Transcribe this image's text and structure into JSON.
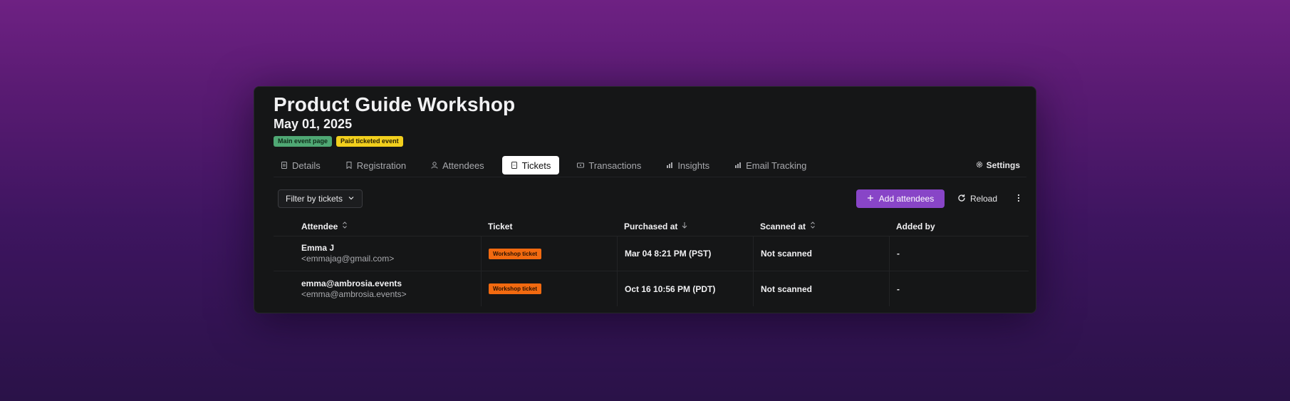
{
  "event": {
    "title": "Product Guide Workshop",
    "date": "May 01, 2025",
    "badges": [
      {
        "label": "Main event page",
        "color": "#4fa874"
      },
      {
        "label": "Paid ticketed event",
        "color": "#f2cf1d"
      }
    ]
  },
  "tabs": [
    {
      "label": "Details",
      "icon": "document-icon",
      "active": false
    },
    {
      "label": "Registration",
      "icon": "bookmark-icon",
      "active": false
    },
    {
      "label": "Attendees",
      "icon": "user-icon",
      "active": false
    },
    {
      "label": "Tickets",
      "icon": "ticket-icon",
      "active": true
    },
    {
      "label": "Transactions",
      "icon": "card-icon",
      "active": false
    },
    {
      "label": "Insights",
      "icon": "bar-chart-icon",
      "active": false
    },
    {
      "label": "Email Tracking",
      "icon": "bar-chart-icon",
      "active": false
    }
  ],
  "settings_label": "Settings",
  "toolbar": {
    "filter_label": "Filter by tickets",
    "add_label": "Add attendees",
    "reload_label": "Reload",
    "accent": "#8845c7"
  },
  "table": {
    "columns": [
      {
        "label": "Attendee",
        "sort": "unsorted"
      },
      {
        "label": "Ticket",
        "sort": "none"
      },
      {
        "label": "Purchased at",
        "sort": "descending"
      },
      {
        "label": "Scanned at",
        "sort": "unsorted"
      },
      {
        "label": "Added by",
        "sort": "none"
      }
    ],
    "rows": [
      {
        "name": "Emma J",
        "email": "<emmajag@gmail.com>",
        "ticket": "Workshop ticket",
        "purchased": "Mar 04 8:21 PM (PST)",
        "scanned": "Not scanned",
        "added_by": "-"
      },
      {
        "name": "emma@ambrosia.events",
        "email": "<emma@ambrosia.events>",
        "ticket": "Workshop ticket",
        "purchased": "Oct 16 10:56 PM (PDT)",
        "scanned": "Not scanned",
        "added_by": "-"
      }
    ],
    "ticket_color": "#f26a10"
  }
}
